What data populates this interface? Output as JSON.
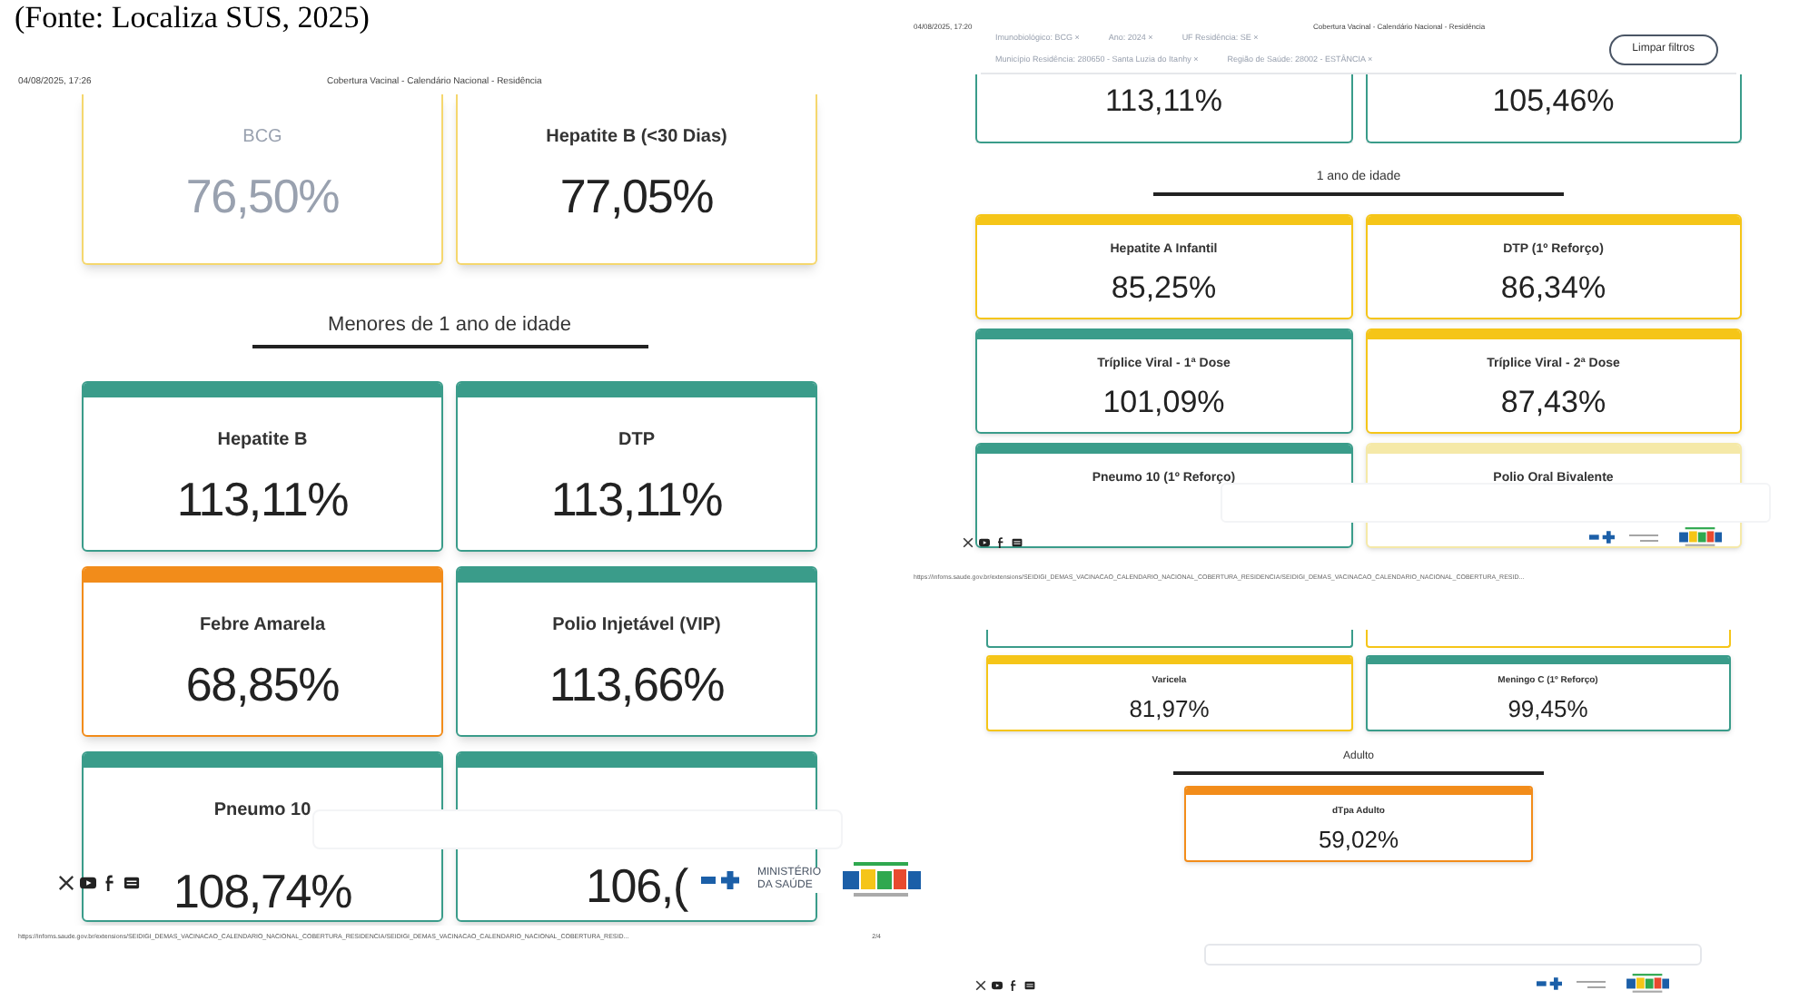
{
  "caption": "(Fonte: Localiza SUS, 2025)",
  "left_page": {
    "date": "04/08/2025, 17:26",
    "title": "Cobertura Vacinal - Calendário Nacional - Residência",
    "top_cards": [
      {
        "title": "BCG",
        "value": "76,50%",
        "color": "#f5d76e",
        "faded": true
      },
      {
        "title": "Hepatite B (<30 Dias)",
        "value": "77,05%",
        "color": "#f5d76e",
        "faded": false
      }
    ],
    "section": "Menores de 1 ano de idade",
    "cards": [
      {
        "title": "Hepatite B",
        "value": "113,11%",
        "color": "#3a9c8a"
      },
      {
        "title": "DTP",
        "value": "113,11%",
        "color": "#3a9c8a"
      },
      {
        "title": "Febre Amarela",
        "value": "68,85%",
        "color": "#f28c1a"
      },
      {
        "title": "Polio Injetável (VIP)",
        "value": "113,66%",
        "color": "#3a9c8a"
      },
      {
        "title": "Pneumo 10",
        "value": "108,74%",
        "color": "#3a9c8a"
      },
      {
        "value": "106,(",
        "color": "#3a9c8a"
      }
    ],
    "ministry": "MINISTÉRIO DA SAÚDE",
    "url": "https://infoms.saude.gov.br/extensions/SEIDIGI_DEMAS_VACINACAO_CALENDARIO_NACIONAL_COBERTURA_RESIDENCIA/SEIDIGI_DEMAS_VACINACAO_CALENDARIO_NACIONAL_COBERTURA_RESID...",
    "page": "2/4"
  },
  "right_page": {
    "date": "04/08/2025, 17:20",
    "title": "Cobertura Vacinal - Calendário Nacional - Residência",
    "filters": [
      [
        "Imunobiológico: BCG ×",
        "Ano: 2024 ×",
        "UF Residência: SE ×"
      ],
      [
        "Município Residência: 280650 - Santa Luzia do Itanhy ×",
        "Região de Saúde: 28002 - ESTÂNCIA ×"
      ]
    ],
    "clear_button": "Limpar filtros",
    "top_values": [
      {
        "value": "113,11%",
        "color": "#3a9c8a"
      },
      {
        "value": "105,46%",
        "color": "#3a9c8a"
      }
    ],
    "section": "1 ano de idade",
    "cards": [
      {
        "title": "Hepatite A Infantil",
        "value": "85,25%",
        "color": "#f5c518"
      },
      {
        "title": "DTP (1º Reforço)",
        "value": "86,34%",
        "color": "#f5c518"
      },
      {
        "title": "Tríplice Viral - 1ª Dose",
        "value": "101,09%",
        "color": "#3a9c8a"
      },
      {
        "title": "Tríplice Viral - 2ª Dose",
        "value": "87,43%",
        "color": "#f5c518"
      },
      {
        "title": "Pneumo 10 (1º Reforço)",
        "color": "#3a9c8a"
      },
      {
        "title": "Polio Oral Bivalente",
        "color": "#f5e9a8"
      }
    ],
    "url": "https://infoms.saude.gov.br/extensions/SEIDIGI_DEMAS_VACINACAO_CALENDARIO_NACIONAL_COBERTURA_RESIDENCIA/SEIDIGI_DEMAS_VACINACAO_CALENDARIO_NACIONAL_COBERTURA_RESID..."
  },
  "bottom_page": {
    "cut_cards": [
      {
        "color": "#3a9c8a"
      },
      {
        "color": "#f5c518"
      }
    ],
    "cards": [
      {
        "title": "Varicela",
        "value": "81,97%",
        "color": "#f5c518"
      },
      {
        "title": "Meningo C (1º Reforço)",
        "value": "99,45%",
        "color": "#3a9c8a"
      }
    ],
    "section": "Adulto",
    "adult_card": {
      "title": "dTpa Adulto",
      "value": "59,02%",
      "color": "#f28c1a"
    }
  }
}
